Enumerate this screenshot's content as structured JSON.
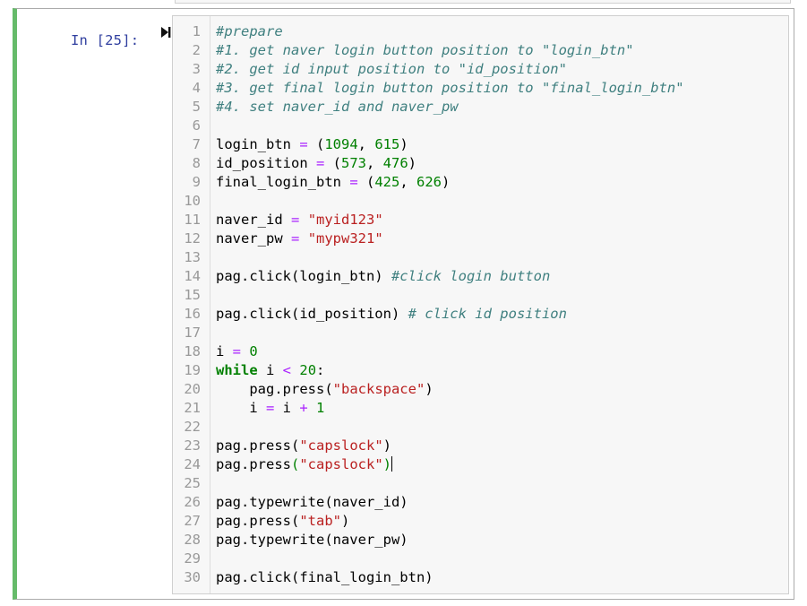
{
  "prompt": "In [25]:",
  "run_icon": "run-cell-icon",
  "lines": [
    {
      "n": "1",
      "segs": [
        {
          "t": "#prepare",
          "c": "cm"
        }
      ]
    },
    {
      "n": "2",
      "segs": [
        {
          "t": "#1. get naver login button position to \"login_btn\"",
          "c": "cm"
        }
      ]
    },
    {
      "n": "3",
      "segs": [
        {
          "t": "#2. get id input position to \"id_position\"",
          "c": "cm"
        }
      ]
    },
    {
      "n": "4",
      "segs": [
        {
          "t": "#3. get final login button position to \"final_login_btn\"",
          "c": "cm"
        }
      ]
    },
    {
      "n": "5",
      "segs": [
        {
          "t": "#4. set naver_id and naver_pw",
          "c": "cm"
        }
      ]
    },
    {
      "n": "6",
      "segs": []
    },
    {
      "n": "7",
      "segs": [
        {
          "t": "login_btn ",
          "c": ""
        },
        {
          "t": "=",
          "c": "op"
        },
        {
          "t": " (",
          "c": ""
        },
        {
          "t": "1094",
          "c": "nu"
        },
        {
          "t": ", ",
          "c": ""
        },
        {
          "t": "615",
          "c": "nu"
        },
        {
          "t": ")",
          "c": ""
        }
      ]
    },
    {
      "n": "8",
      "segs": [
        {
          "t": "id_position ",
          "c": ""
        },
        {
          "t": "=",
          "c": "op"
        },
        {
          "t": " (",
          "c": ""
        },
        {
          "t": "573",
          "c": "nu"
        },
        {
          "t": ", ",
          "c": ""
        },
        {
          "t": "476",
          "c": "nu"
        },
        {
          "t": ")",
          "c": ""
        }
      ]
    },
    {
      "n": "9",
      "segs": [
        {
          "t": "final_login_btn ",
          "c": ""
        },
        {
          "t": "=",
          "c": "op"
        },
        {
          "t": " (",
          "c": ""
        },
        {
          "t": "425",
          "c": "nu"
        },
        {
          "t": ", ",
          "c": ""
        },
        {
          "t": "626",
          "c": "nu"
        },
        {
          "t": ")",
          "c": ""
        }
      ]
    },
    {
      "n": "10",
      "segs": []
    },
    {
      "n": "11",
      "segs": [
        {
          "t": "naver_id ",
          "c": ""
        },
        {
          "t": "=",
          "c": "op"
        },
        {
          "t": " ",
          "c": ""
        },
        {
          "t": "\"myid123\"",
          "c": "st"
        }
      ]
    },
    {
      "n": "12",
      "segs": [
        {
          "t": "naver_pw ",
          "c": ""
        },
        {
          "t": "=",
          "c": "op"
        },
        {
          "t": " ",
          "c": ""
        },
        {
          "t": "\"mypw321\"",
          "c": "st"
        }
      ]
    },
    {
      "n": "13",
      "segs": []
    },
    {
      "n": "14",
      "segs": [
        {
          "t": "pag.click(login_btn) ",
          "c": ""
        },
        {
          "t": "#click login button",
          "c": "cm"
        }
      ]
    },
    {
      "n": "15",
      "segs": []
    },
    {
      "n": "16",
      "segs": [
        {
          "t": "pag.click(id_position) ",
          "c": ""
        },
        {
          "t": "# click id position",
          "c": "cm"
        }
      ]
    },
    {
      "n": "17",
      "segs": []
    },
    {
      "n": "18",
      "segs": [
        {
          "t": "i ",
          "c": ""
        },
        {
          "t": "=",
          "c": "op"
        },
        {
          "t": " ",
          "c": ""
        },
        {
          "t": "0",
          "c": "nu"
        }
      ]
    },
    {
      "n": "19",
      "segs": [
        {
          "t": "while",
          "c": "kw"
        },
        {
          "t": " i ",
          "c": ""
        },
        {
          "t": "<",
          "c": "op"
        },
        {
          "t": " ",
          "c": ""
        },
        {
          "t": "20",
          "c": "nu"
        },
        {
          "t": ":",
          "c": ""
        }
      ]
    },
    {
      "n": "20",
      "segs": [
        {
          "t": "    pag.press(",
          "c": ""
        },
        {
          "t": "\"backspace\"",
          "c": "st"
        },
        {
          "t": ")",
          "c": ""
        }
      ]
    },
    {
      "n": "21",
      "segs": [
        {
          "t": "    i ",
          "c": ""
        },
        {
          "t": "=",
          "c": "op"
        },
        {
          "t": " i ",
          "c": ""
        },
        {
          "t": "+",
          "c": "op"
        },
        {
          "t": " ",
          "c": ""
        },
        {
          "t": "1",
          "c": "nu"
        }
      ]
    },
    {
      "n": "22",
      "segs": []
    },
    {
      "n": "23",
      "segs": [
        {
          "t": "pag.press(",
          "c": ""
        },
        {
          "t": "\"capslock\"",
          "c": "st"
        },
        {
          "t": ")",
          "c": ""
        }
      ]
    },
    {
      "n": "24",
      "segs": [
        {
          "t": "pag.press",
          "c": ""
        },
        {
          "t": "(",
          "c": "nu"
        },
        {
          "t": "\"capslock\"",
          "c": "st"
        },
        {
          "t": ")",
          "c": "nu"
        }
      ],
      "cursor": true
    },
    {
      "n": "25",
      "segs": []
    },
    {
      "n": "26",
      "segs": [
        {
          "t": "pag.typewrite(naver_id)",
          "c": ""
        }
      ]
    },
    {
      "n": "27",
      "segs": [
        {
          "t": "pag.press(",
          "c": ""
        },
        {
          "t": "\"tab\"",
          "c": "st"
        },
        {
          "t": ")",
          "c": ""
        }
      ]
    },
    {
      "n": "28",
      "segs": [
        {
          "t": "pag.typewrite(naver_pw)",
          "c": ""
        }
      ]
    },
    {
      "n": "29",
      "segs": []
    },
    {
      "n": "30",
      "segs": [
        {
          "t": "pag.click(final_login_btn)",
          "c": ""
        }
      ]
    }
  ]
}
